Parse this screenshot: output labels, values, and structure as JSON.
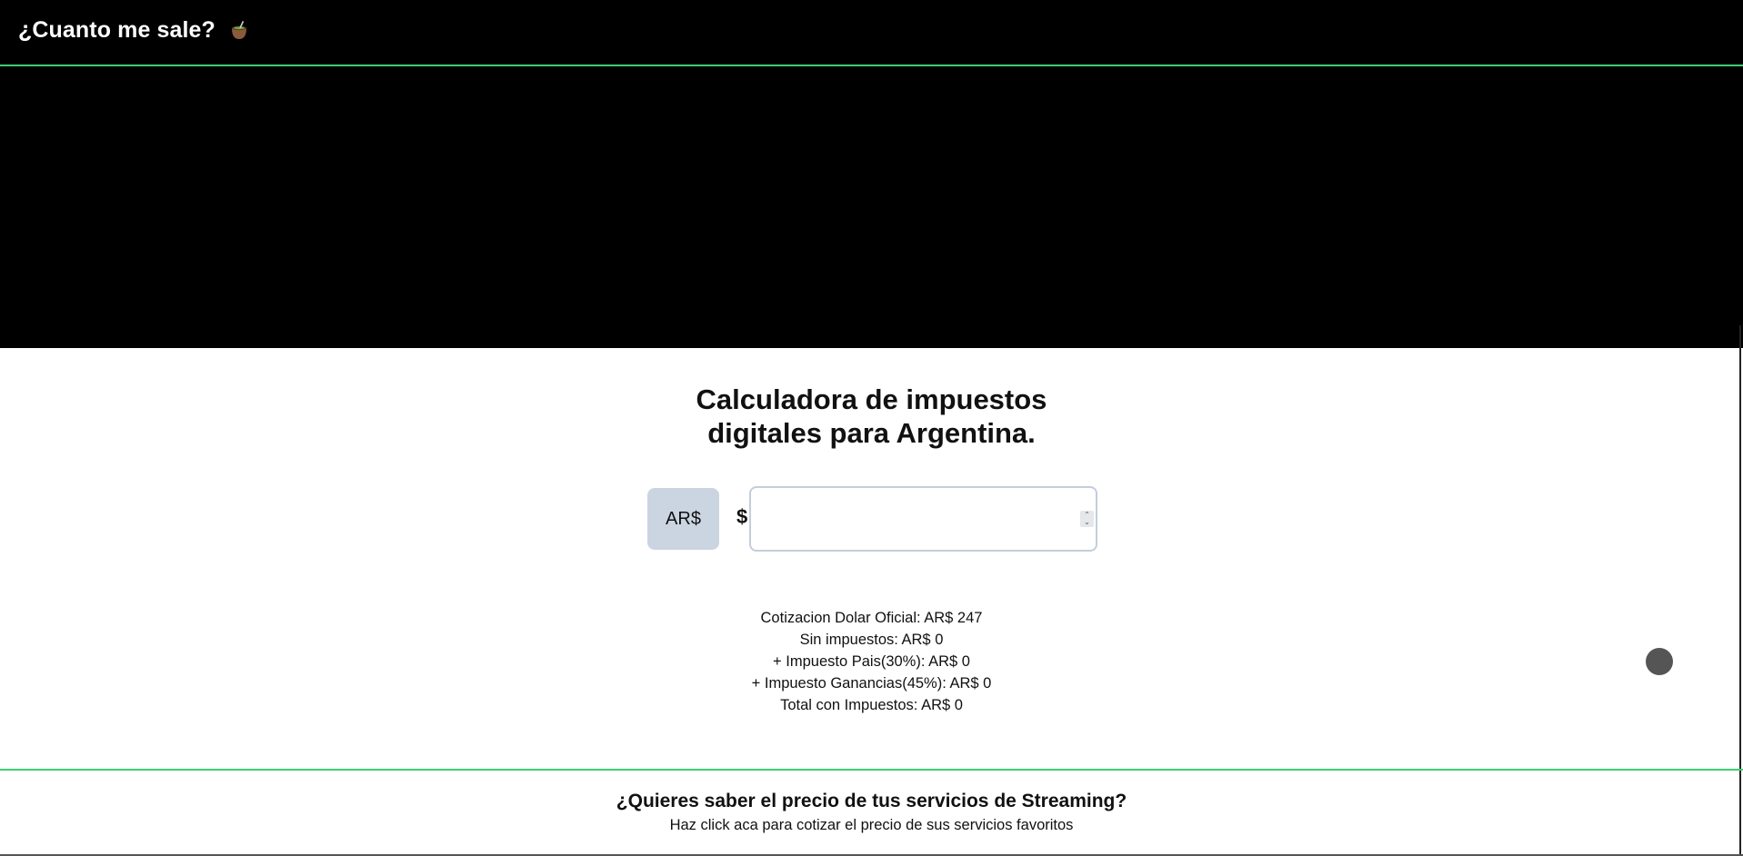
{
  "header": {
    "brand": "¿Cuanto me sale?",
    "brand_icon": "mate-icon"
  },
  "main": {
    "title_line1": "Calculadora de impuestos",
    "title_line2": "digitales para Argentina.",
    "currency_button": "AR$",
    "dollar_sign": "$",
    "amount_value": "",
    "amount_placeholder": "",
    "results": [
      "Cotizacion Dolar Oficial: AR$ 247",
      "Sin impuestos: AR$ 0",
      "+ Impuesto Pais(30%): AR$ 0",
      "+ Impuesto Ganancias(45%): AR$ 0",
      "Total con Impuestos: AR$ 0"
    ]
  },
  "footer": {
    "cta_title": "¿Quieres saber el precio de tus servicios de Streaming?",
    "cta_subtitle": "Haz click aca para cotizar el precio de sus servicios favoritos"
  },
  "colors": {
    "accent_line": "#3ecf6e",
    "currency_button_bg": "#cbd5e1",
    "header_bg": "#000000"
  }
}
